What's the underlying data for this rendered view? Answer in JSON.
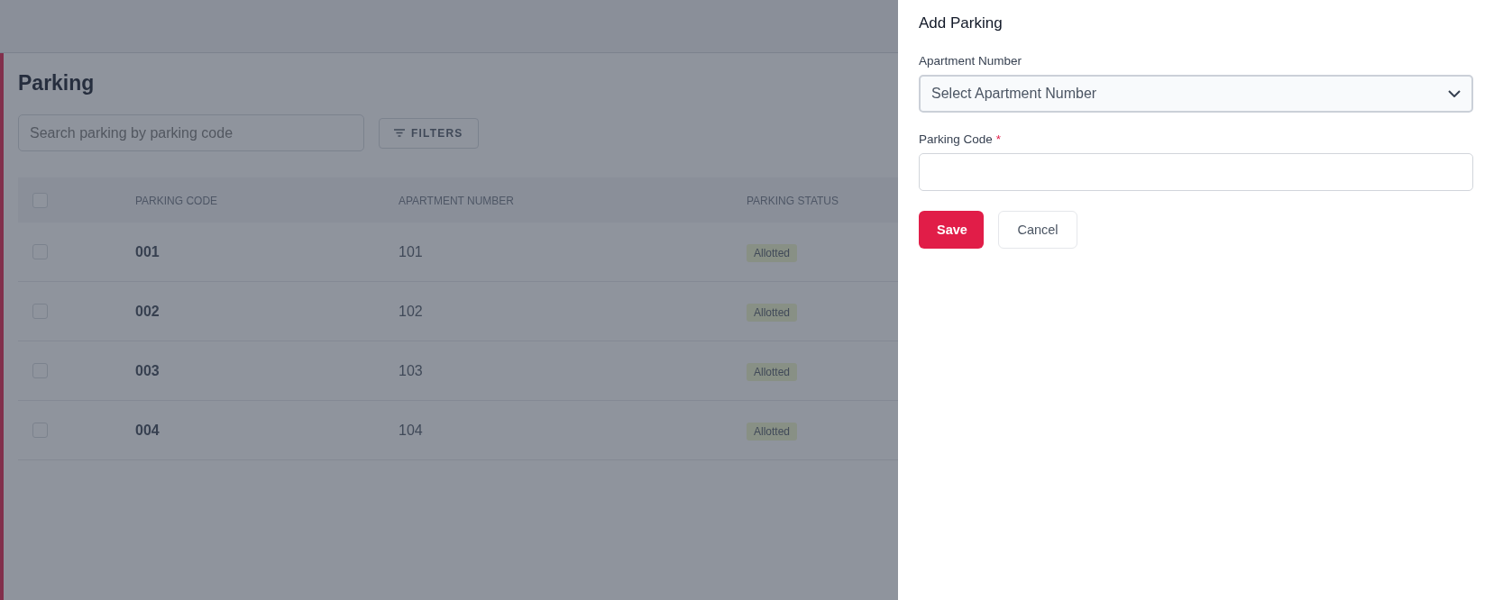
{
  "page": {
    "title": "Parking",
    "search": {
      "placeholder": "Search parking by parking code"
    },
    "filters_button": "FILTERS",
    "table": {
      "select_all": {
        "checked": false
      },
      "columns": [
        "PARKING CODE",
        "APARTMENT NUMBER",
        "PARKING STATUS"
      ],
      "rows": [
        {
          "checked": false,
          "parking_code": "001",
          "apartment_number": "101",
          "status": "Allotted"
        },
        {
          "checked": false,
          "parking_code": "002",
          "apartment_number": "102",
          "status": "Allotted"
        },
        {
          "checked": false,
          "parking_code": "003",
          "apartment_number": "103",
          "status": "Allotted"
        },
        {
          "checked": false,
          "parking_code": "004",
          "apartment_number": "104",
          "status": "Allotted"
        }
      ]
    }
  },
  "drawer": {
    "title": "Add Parking",
    "fields": [
      {
        "kind": "select",
        "label": "Apartment Number",
        "placeholder": "Select Apartment Number"
      },
      {
        "kind": "text",
        "label": "Parking Code",
        "required_mark": "*"
      }
    ],
    "buttons": [
      {
        "kind": "primary",
        "label": "Save"
      },
      {
        "kind": "secondary",
        "label": "Cancel"
      }
    ]
  }
}
